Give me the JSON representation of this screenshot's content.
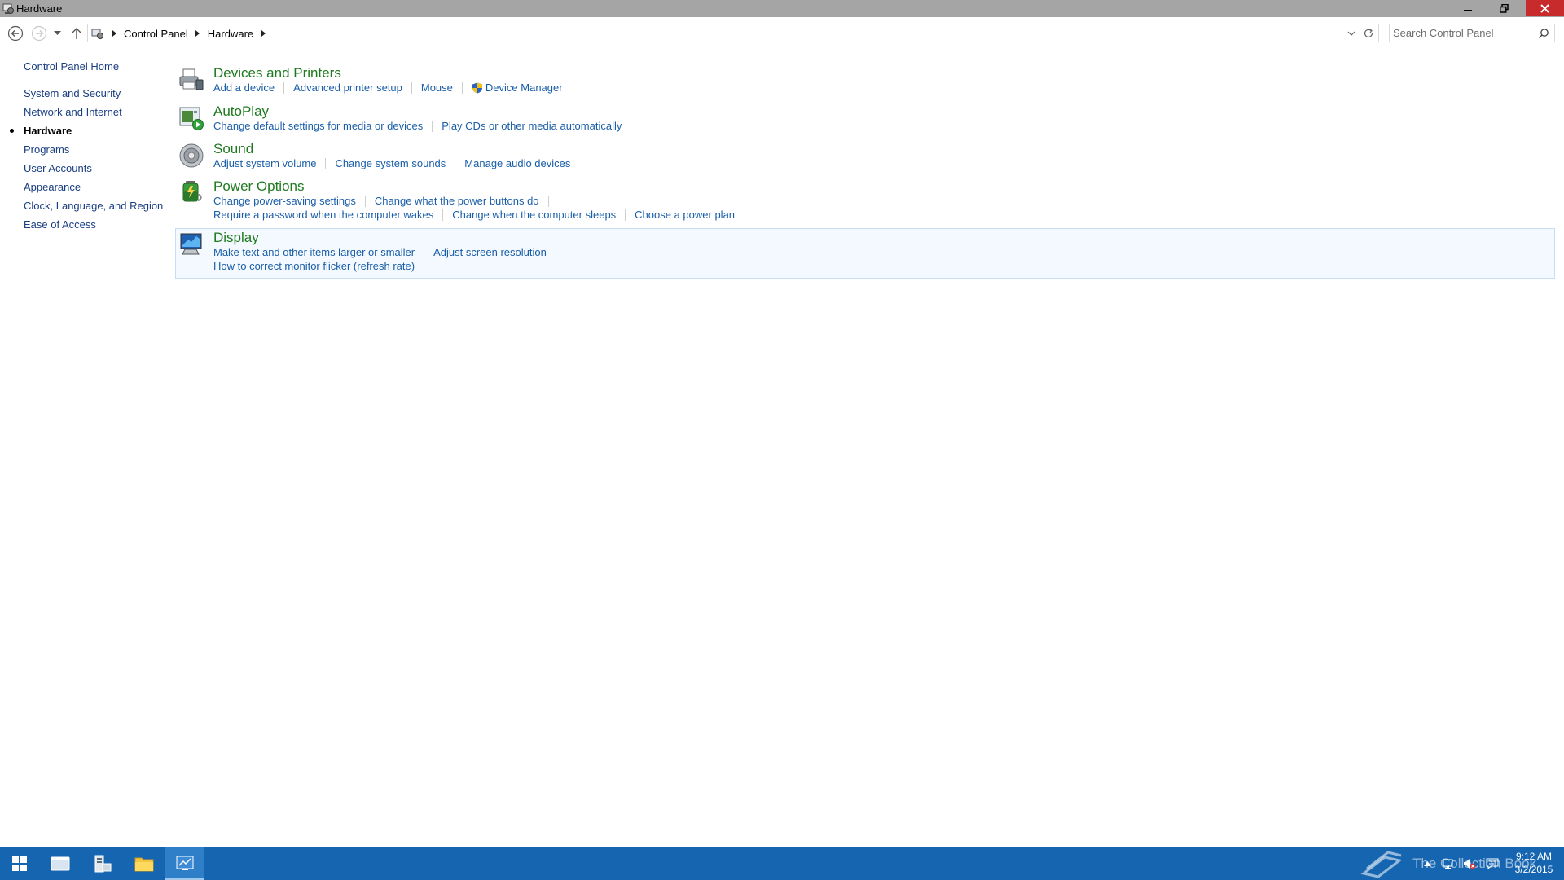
{
  "window": {
    "title": "Hardware"
  },
  "breadcrumb": {
    "items": [
      "Control Panel",
      "Hardware"
    ]
  },
  "search": {
    "placeholder": "Search Control Panel"
  },
  "sidebar": {
    "home": "Control Panel Home",
    "items": [
      "System and Security",
      "Network and Internet",
      "Hardware",
      "Programs",
      "User Accounts",
      "Appearance",
      "Clock, Language, and Region",
      "Ease of Access"
    ],
    "current": "Hardware"
  },
  "categories": [
    {
      "title": "Devices and Printers",
      "icon": "printer-icon",
      "rows": [
        [
          "Add a device",
          "Advanced printer setup",
          "Mouse",
          "Device Manager"
        ]
      ]
    },
    {
      "title": "AutoPlay",
      "icon": "autoplay-icon",
      "rows": [
        [
          "Change default settings for media or devices",
          "Play CDs or other media automatically"
        ]
      ]
    },
    {
      "title": "Sound",
      "icon": "speaker-icon",
      "rows": [
        [
          "Adjust system volume",
          "Change system sounds",
          "Manage audio devices"
        ]
      ]
    },
    {
      "title": "Power Options",
      "icon": "battery-icon",
      "rows": [
        [
          "Change power-saving settings",
          "Change what the power buttons do"
        ],
        [
          "Require a password when the computer wakes",
          "Change when the computer sleeps",
          "Choose a power plan"
        ]
      ]
    },
    {
      "title": "Display",
      "icon": "monitor-icon",
      "rows": [
        [
          "Make text and other items larger or smaller",
          "Adjust screen resolution"
        ],
        [
          "How to correct monitor flicker (refresh rate)"
        ]
      ]
    }
  ],
  "taskbar": {
    "watermark": "The Collection Book",
    "time": "9:12 AM",
    "date": "3/2/2015"
  },
  "colors": {
    "titlebar": "#a5a5a5",
    "taskbar": "#1565b0",
    "category_title": "#1f7a1f",
    "link": "#1a5ea8",
    "highlight_bg": "#f3f9fe"
  }
}
